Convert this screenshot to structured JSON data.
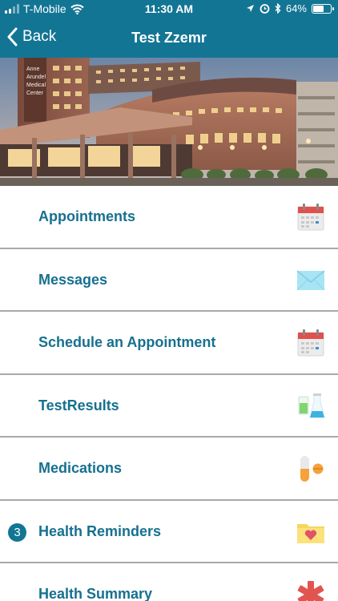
{
  "status_bar": {
    "carrier": "T-Mobile",
    "time": "11:30 AM",
    "battery_percent": "64%",
    "battery_level": 0.64,
    "icons": [
      "signal-icon",
      "wifi-icon",
      "location-icon",
      "alarm-icon",
      "bluetooth-icon",
      "battery-icon"
    ]
  },
  "nav": {
    "back_label": "Back",
    "title": "Test Zzemr"
  },
  "hero": {
    "sign_text": [
      "Anne",
      "Arundel",
      "Medical",
      "Center"
    ]
  },
  "menu": [
    {
      "label": "Appointments",
      "icon": "calendar-icon"
    },
    {
      "label": "Messages",
      "icon": "envelope-icon"
    },
    {
      "label": "Schedule an Appointment",
      "icon": "calendar-icon"
    },
    {
      "label": "TestResults",
      "icon": "lab-flask-icon"
    },
    {
      "label": "Medications",
      "icon": "pill-icon"
    },
    {
      "label": "Health Reminders",
      "icon": "heart-folder-icon",
      "badge": "3"
    },
    {
      "label": "Health Summary",
      "icon": "medical-star-icon"
    }
  ],
  "colors": {
    "brand": "#137594",
    "label": "#16708f",
    "divider": "#a9a9a9"
  }
}
